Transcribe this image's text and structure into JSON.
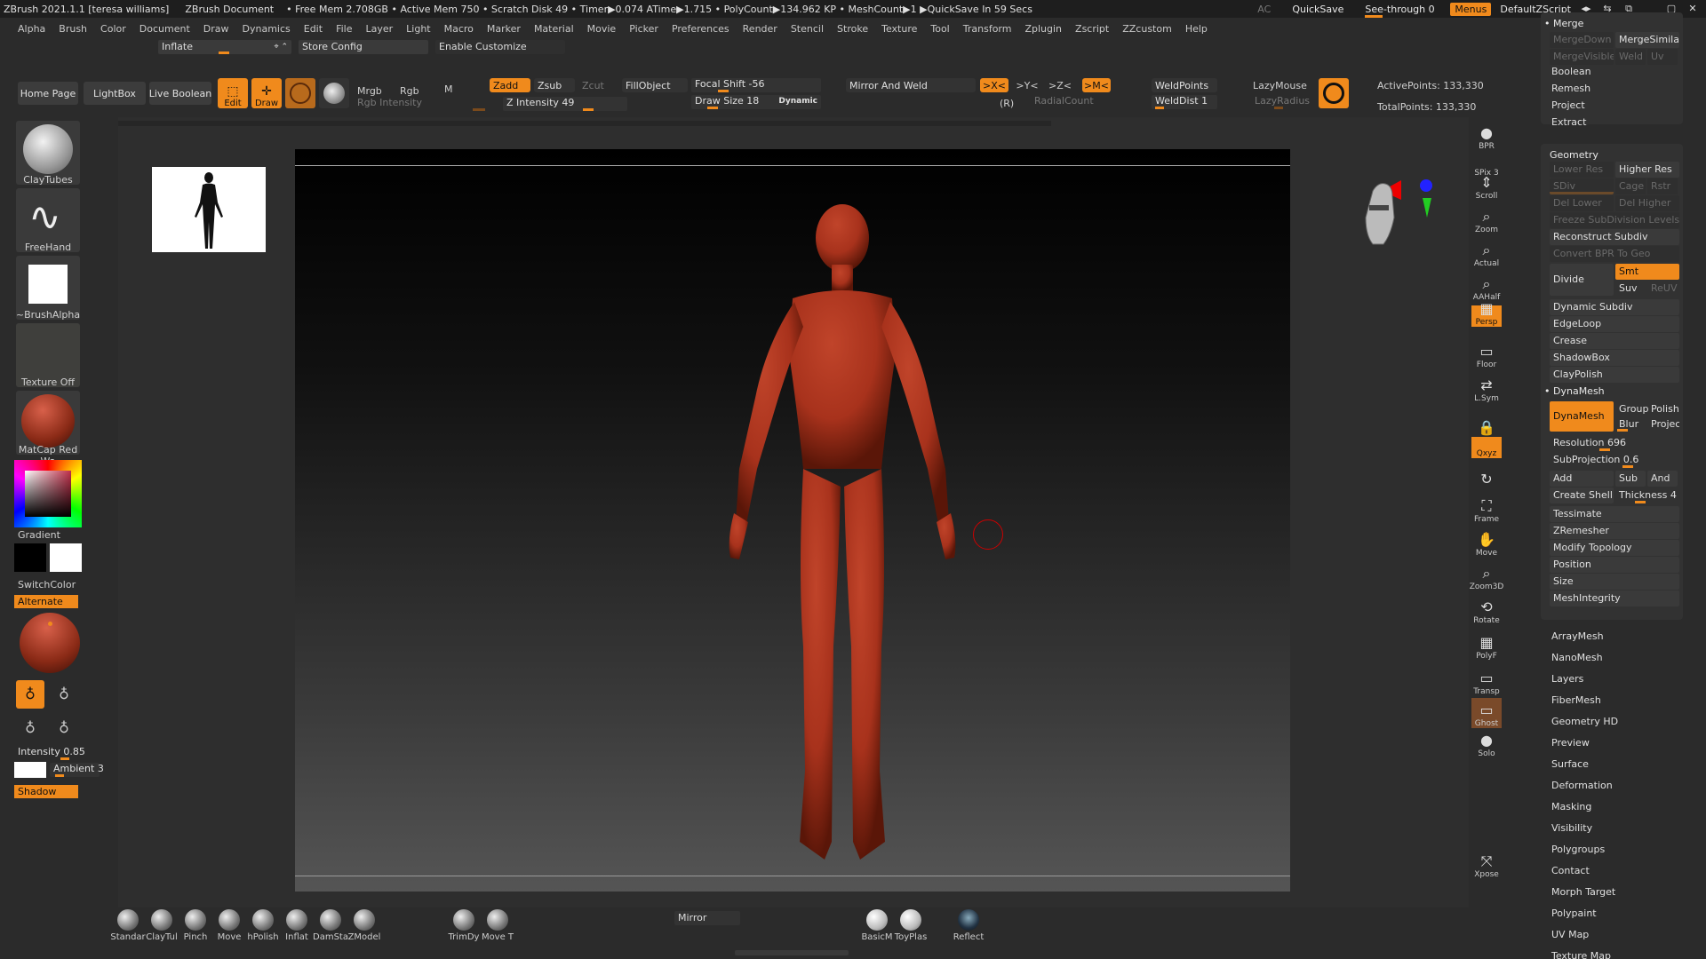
{
  "titlebar": {
    "app": "ZBrush 2021.1.1 [teresa williams]",
    "document": "ZBrush Document",
    "stats": "• Free Mem 2.708GB • Active Mem 750 • Scratch Disk 49 • Timer▶0.074 ATime▶1.715 • PolyCount▶134.962 KP • MeshCount▶1 ▶QuickSave In 59 Secs",
    "ac": "AC",
    "quicksave": "QuickSave",
    "see_through": "See-through  0",
    "menus": "Menus",
    "script": "DefaultZScript"
  },
  "menubar": [
    "Alpha",
    "Brush",
    "Color",
    "Document",
    "Draw",
    "Dynamics",
    "Edit",
    "File",
    "Layer",
    "Light",
    "Macro",
    "Marker",
    "Material",
    "Movie",
    "Picker",
    "Preferences",
    "Render",
    "Stencil",
    "Stroke",
    "Texture",
    "Tool",
    "Transform",
    "Zplugin",
    "Zscript",
    "ZZcustom",
    "Help"
  ],
  "row2": {
    "inflate": "Inflate",
    "store_config": "Store Config",
    "enable_customize": "Enable Customize"
  },
  "shelf": {
    "home_page": "Home Page",
    "lightbox": "LightBox",
    "live_boolean": "Live Boolean",
    "edit": "Edit",
    "draw": "Draw",
    "mrgb": "Mrgb",
    "rgb": "Rgb",
    "m": "M",
    "rgb_intensity": "Rgb Intensity",
    "zadd": "Zadd",
    "zsub": "Zsub",
    "zcut": "Zcut",
    "z_intensity": "Z Intensity 49",
    "fill_object": "FillObject",
    "focal_shift": "Focal Shift -56",
    "draw_size": "Draw Size 18",
    "dynamic": "Dynamic",
    "mirror_weld": "Mirror And Weld",
    "x_sym": ">X<",
    "y_sym": ">Y<",
    "z_sym": ">Z<",
    "m_sym": ">M<",
    "r_label": "(R)",
    "radial_count": "RadialCount",
    "weld_points": "WeldPoints",
    "weld_dist": "WeldDist 1",
    "lazy_mouse": "LazyMouse",
    "lazy_radius": "LazyRadius",
    "active_points": "ActivePoints: 133,330",
    "total_points": "TotalPoints: 133,330"
  },
  "lefttray": {
    "brush1": "ClayTubes",
    "brush2": "FreeHand",
    "alpha": "~BrushAlpha",
    "texture": "Texture Off",
    "material": "MatCap Red Wa",
    "gradient": "Gradient",
    "switch_color": "SwitchColor",
    "alternate": "Alternate",
    "intensity": "Intensity 0.85",
    "ambient": "Ambient 3",
    "shadow": "Shadow"
  },
  "rightbar": [
    {
      "label": "BPR",
      "glyph": "●"
    },
    {
      "label": "SPix 3",
      "glyph": ""
    },
    {
      "label": "Scroll",
      "glyph": "⇕"
    },
    {
      "label": "Zoom",
      "glyph": "⌕"
    },
    {
      "label": "Actual",
      "glyph": "⌕"
    },
    {
      "label": "AAHalf",
      "glyph": "⌕"
    },
    {
      "label": "Persp",
      "glyph": "▦"
    },
    {
      "label": "Floor",
      "glyph": "▭"
    },
    {
      "label": "L.Sym",
      "glyph": "⇄"
    },
    {
      "label": "",
      "glyph": "🔒"
    },
    {
      "label": "Qxyz",
      "glyph": ""
    },
    {
      "label": "",
      "glyph": "↻"
    },
    {
      "label": "Frame",
      "glyph": "⛶"
    },
    {
      "label": "Move",
      "glyph": "✋"
    },
    {
      "label": "Zoom3D",
      "glyph": "⌕"
    },
    {
      "label": "Rotate",
      "glyph": "⟲"
    },
    {
      "label": "PolyF",
      "glyph": "▦"
    },
    {
      "label": "Transp",
      "glyph": "▭"
    },
    {
      "label": "Ghost",
      "glyph": "▭"
    },
    {
      "label": "Solo",
      "glyph": "●"
    },
    {
      "label": "Xpose",
      "glyph": "⤧"
    }
  ],
  "panel": {
    "merge": "Merge",
    "merge_down": "MergeDown",
    "merge_similar": "MergeSimilar",
    "merge_visible": "MergeVisible",
    "weld": "Weld",
    "uv": "Uv",
    "boolean": "Boolean",
    "remesh": "Remesh",
    "project": "Project",
    "extract": "Extract",
    "geometry": "Geometry",
    "lower_res": "Lower Res",
    "higher_res": "Higher Res",
    "sdiv": "SDiv",
    "cage": "Cage",
    "rstr": "Rstr",
    "del_lower": "Del Lower",
    "del_higher": "Del Higher",
    "freeze": "Freeze SubDivision Levels",
    "reconstruct": "Reconstruct Subdiv",
    "convert_bpr": "Convert BPR To Geo",
    "divide": "Divide",
    "smt": "Smt",
    "suv": "Suv",
    "reuv": "ReUV",
    "dynamic_subdiv": "Dynamic Subdiv",
    "edgeloop": "EdgeLoop",
    "crease": "Crease",
    "shadowbox": "ShadowBox",
    "claypolish": "ClayPolish",
    "dynamesh_head": "DynaMesh",
    "dynamesh_btn": "DynaMesh",
    "groups": "Groups",
    "polish": "Polish",
    "blur": "Blur",
    "projec": "Projec",
    "resolution": "Resolution 696",
    "subprojection": "SubProjection 0.6",
    "add": "Add",
    "sub": "Sub",
    "and": "And",
    "create_shell": "Create Shell",
    "thickness": "Thickness 4",
    "tessimate": "Tessimate",
    "zremesher": "ZRemesher",
    "modify_topology": "Modify Topology",
    "position": "Position",
    "size": "Size",
    "meshintegrity": "MeshIntegrity",
    "sub_items": [
      "ArrayMesh",
      "NanoMesh",
      "Layers",
      "FiberMesh",
      "Geometry HD",
      "Preview",
      "Surface",
      "Deformation",
      "Masking",
      "Visibility",
      "Polygroups",
      "Contact",
      "Morph Target",
      "Polypaint",
      "UV Map",
      "Texture Map"
    ]
  },
  "bottomshelf": {
    "brushes": [
      "Standar",
      "ClayTul",
      "Pinch",
      "Move",
      "hPolish",
      "Inflat",
      "DamSta",
      "ZModel"
    ],
    "trim": [
      "TrimDy",
      "Move T"
    ],
    "mirror": "Mirror",
    "mats": [
      "BasicM",
      "ToyPlas"
    ],
    "reflect": "Reflect"
  },
  "colors": {
    "accent": "#f08a1c",
    "material": "#a8321c"
  }
}
